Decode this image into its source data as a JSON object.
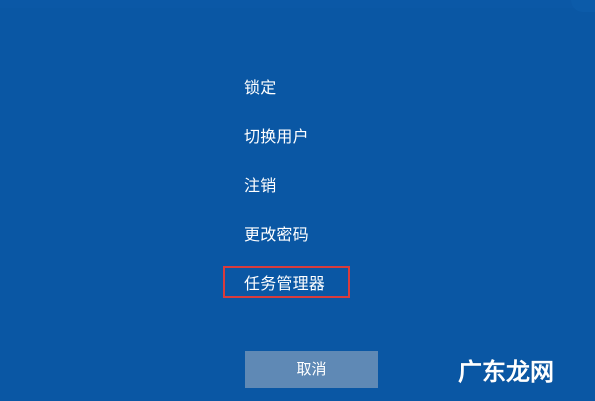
{
  "theme": {
    "background": "#0a57a4",
    "text": "#ffffff",
    "button_background": "#5f89b5",
    "highlight": "#d93b3b"
  },
  "menu": {
    "lock": "锁定",
    "switch_user": "切换用户",
    "sign_out": "注销",
    "change_password": "更改密码",
    "task_manager": "任务管理器"
  },
  "buttons": {
    "cancel": "取消"
  },
  "watermark": {
    "text": "广东龙网"
  }
}
